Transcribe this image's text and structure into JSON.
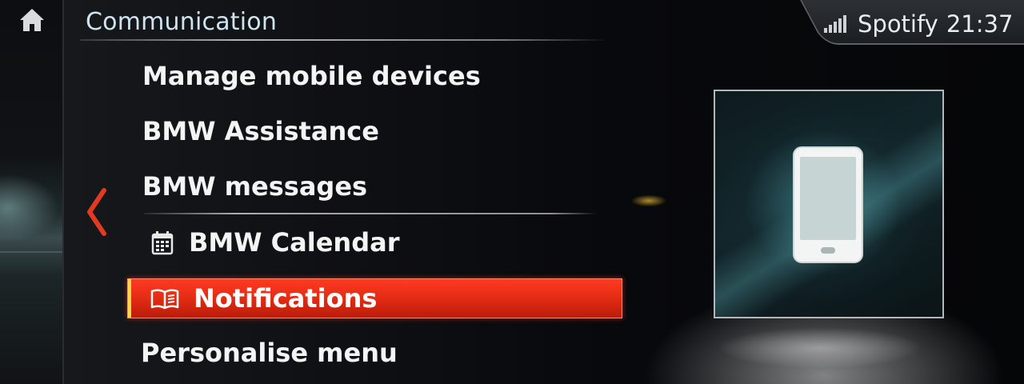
{
  "header": {
    "title": "Communication"
  },
  "status": {
    "source": "Spotify",
    "time": "21:37"
  },
  "menu": {
    "items": [
      {
        "label": "Manage mobile devices"
      },
      {
        "label": "BMW Assistance"
      },
      {
        "label": "BMW messages"
      },
      {
        "label": "BMW Calendar",
        "icon": "calendar-icon"
      },
      {
        "label": "Notifications",
        "icon": "book-icon",
        "selected": true
      },
      {
        "label": "Personalise menu"
      }
    ]
  },
  "illustration": {
    "icon": "smartphone-icon"
  },
  "colors": {
    "accent": "#e8301a",
    "title": "#cfe4ef",
    "selection_bar": "#ffd74a"
  }
}
